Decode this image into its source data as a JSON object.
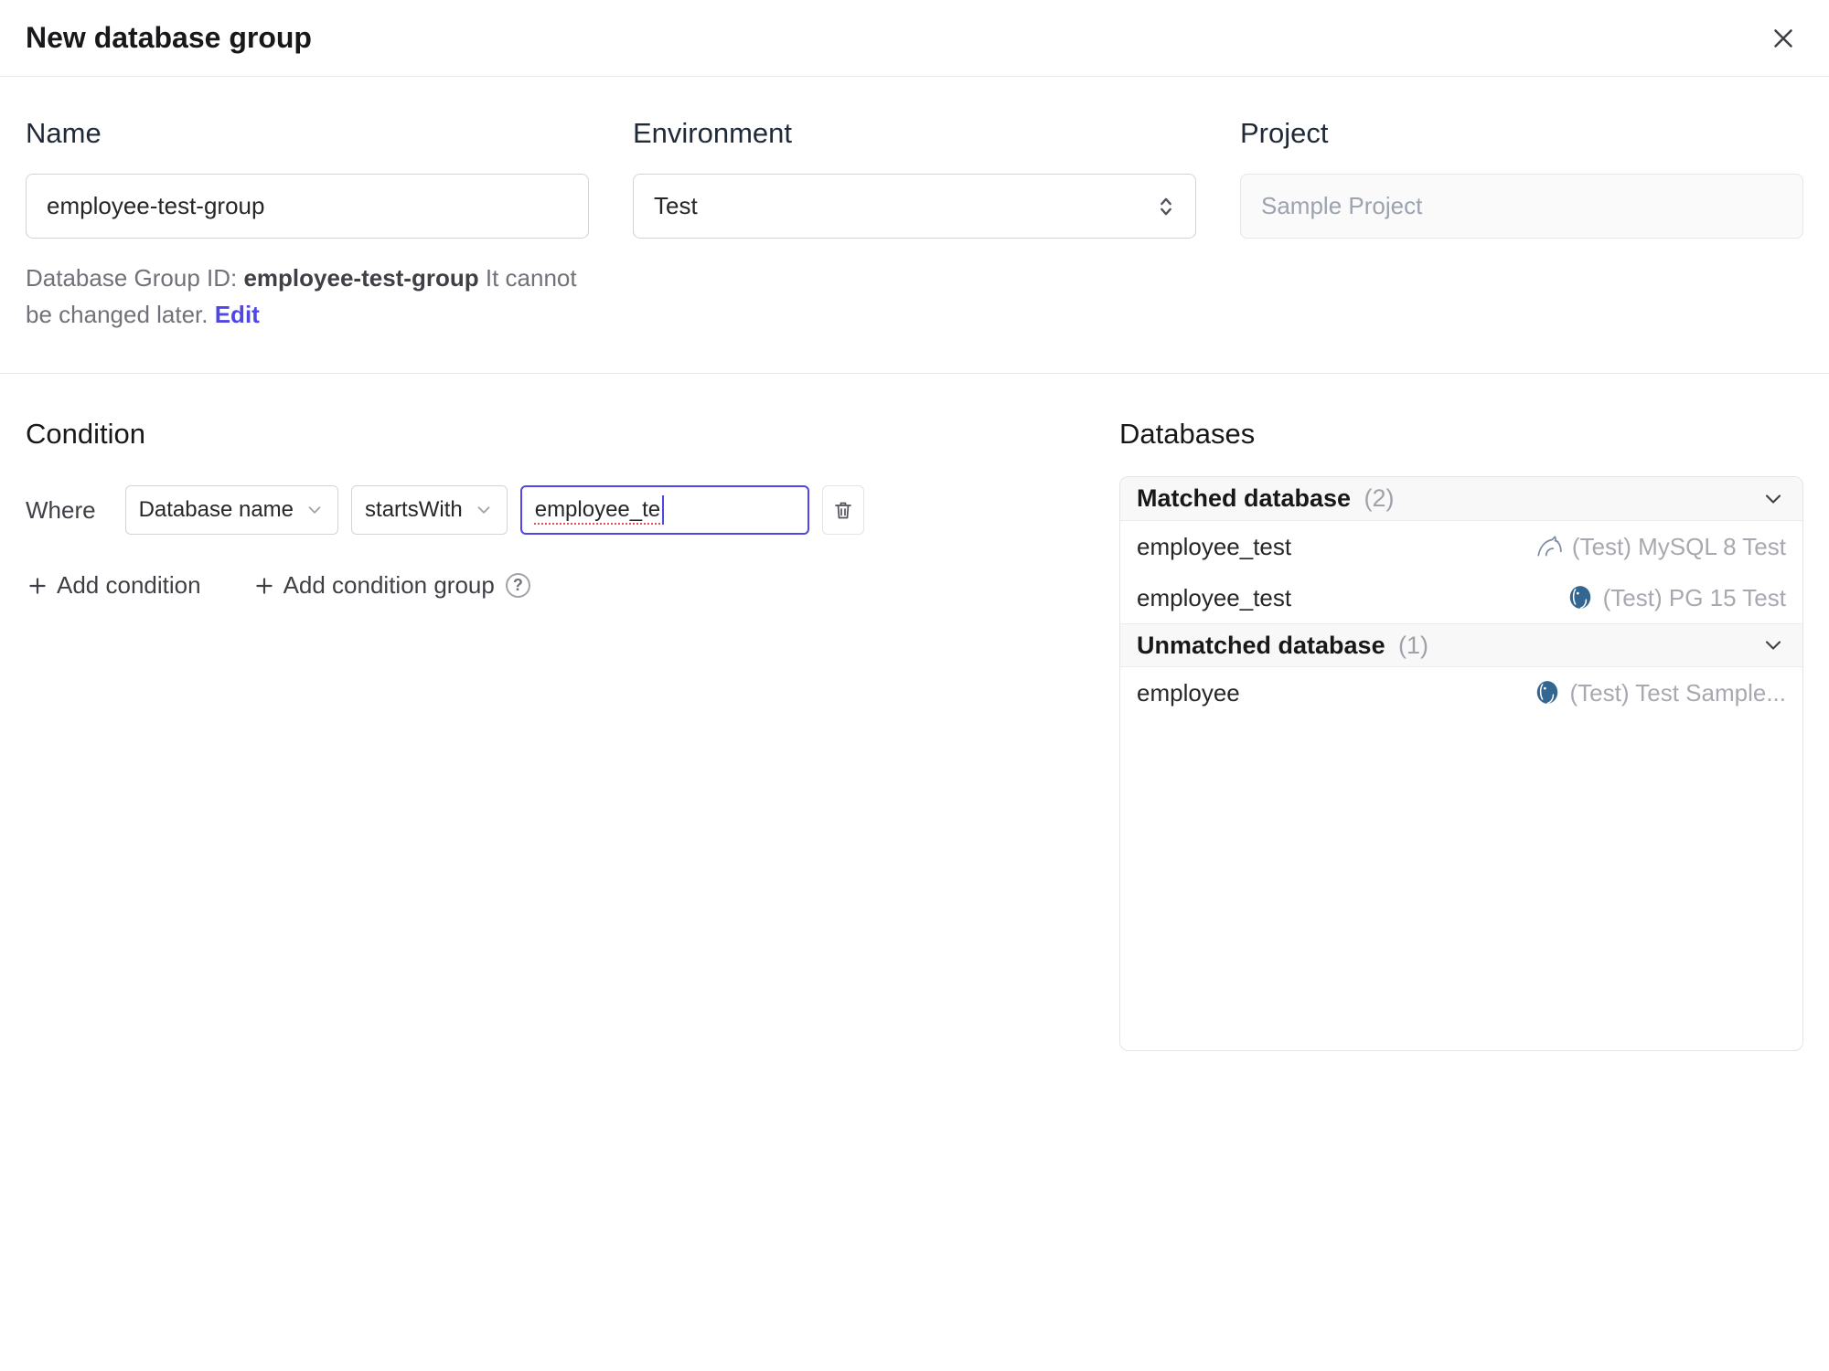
{
  "dialog": {
    "title": "New database group"
  },
  "form": {
    "name": {
      "label": "Name",
      "value": "employee-test-group"
    },
    "environment": {
      "label": "Environment",
      "value": "Test"
    },
    "project": {
      "label": "Project",
      "value": "Sample Project"
    },
    "helper": {
      "prefix": "Database Group ID: ",
      "group_id": "employee-test-group",
      "suffix": " It cannot be changed later. ",
      "edit_label": "Edit"
    }
  },
  "condition": {
    "heading": "Condition",
    "where_label": "Where",
    "field_select": "Database name",
    "operator_select": "startsWith",
    "value": "employee_te",
    "add_condition_label": "Add condition",
    "add_condition_group_label": "Add condition group"
  },
  "databases": {
    "heading": "Databases",
    "groups": [
      {
        "label": "Matched database",
        "count": "(2)",
        "rows": [
          {
            "name": "employee_test",
            "engine": "mysql",
            "instance": "(Test) MySQL 8 Test"
          },
          {
            "name": "employee_test",
            "engine": "postgres",
            "instance": "(Test) PG 15 Test"
          }
        ]
      },
      {
        "label": "Unmatched database",
        "count": "(1)",
        "rows": [
          {
            "name": "employee",
            "engine": "postgres",
            "instance": "(Test) Test Sample..."
          }
        ]
      }
    ]
  },
  "icons": {
    "help_glyph": "?"
  },
  "colors": {
    "accent": "#4f46e5",
    "focus_border": "#4f46e5",
    "spell_error": "#e05252",
    "header_bg": "#f8f8f8",
    "muted_text": "#a1a1aa"
  }
}
